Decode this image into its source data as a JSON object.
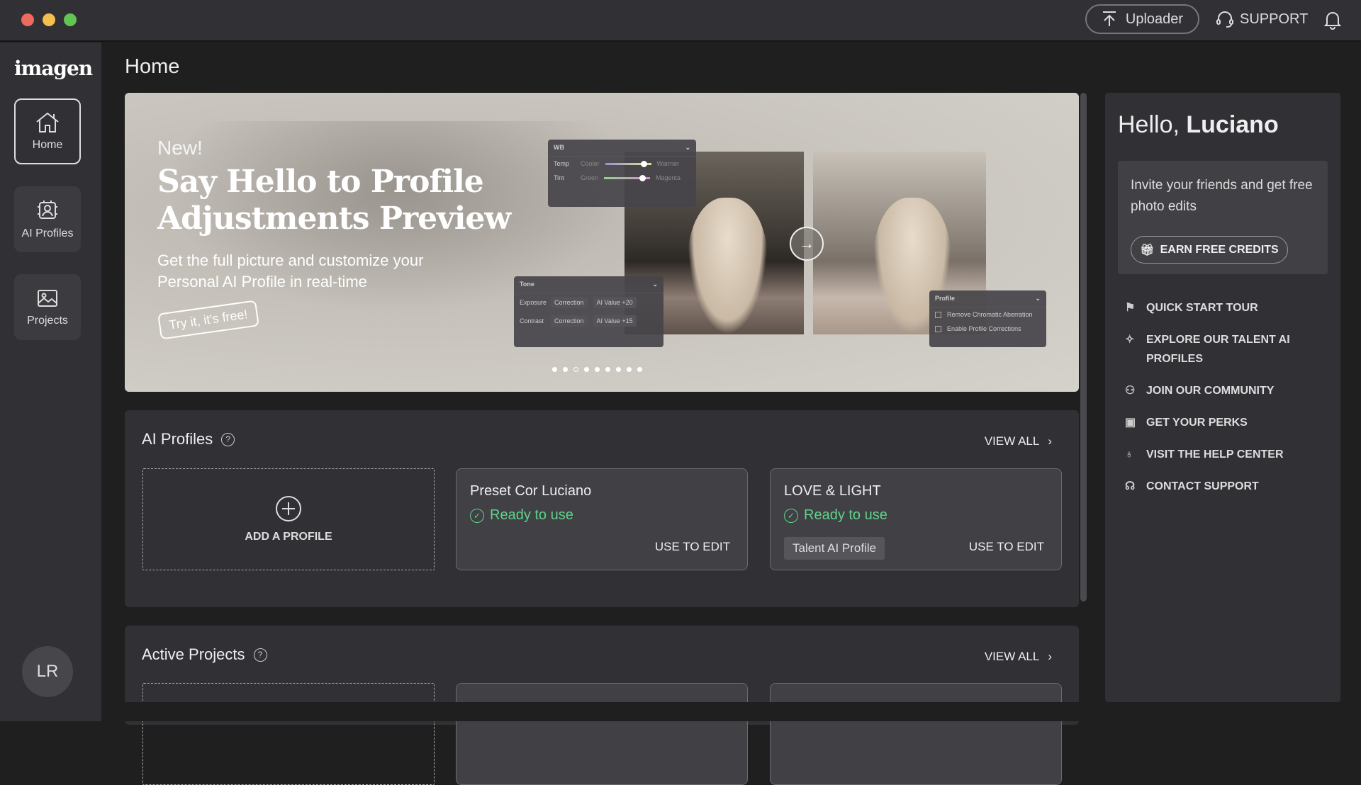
{
  "topbar": {
    "uploader": "Uploader",
    "support": "SUPPORT",
    "colors": {
      "close": "#ed6a5e",
      "minimize": "#f5bf4f",
      "maximize": "#61c554"
    }
  },
  "sidebar": {
    "logo": "imagen",
    "items": [
      {
        "label": "Home",
        "icon": "home-icon",
        "active": true
      },
      {
        "label": "AI Profiles",
        "icon": "ai-profile-icon"
      },
      {
        "label": "Projects",
        "icon": "image-icon"
      }
    ],
    "avatar": "LR"
  },
  "page": {
    "title": "Home"
  },
  "banner": {
    "new": "New!",
    "headline_1": "Say Hello to Profile",
    "headline_2": "Adjustments Preview",
    "subtitle": "Get the full picture and customize your Personal AI Profile in real-time",
    "cta": "Try it, it's free!",
    "wb": {
      "title": "WB",
      "temp": "Temp",
      "cooler": "Cooler",
      "warmer": "Warmer",
      "tint": "Tint",
      "green": "Green",
      "magenta": "Magenta"
    },
    "tone": {
      "title": "Tone",
      "exposure": "Exposure",
      "contrast": "Contrast",
      "correction": "Correction",
      "exposure_value": "AI Value +20",
      "contrast_value": "AI Value +15"
    },
    "profile": {
      "title": "Profile",
      "opt1": "Remove Chromatic Aberration",
      "opt2": "Enable Profile Corrections"
    },
    "slides": 9,
    "current_slide": 3
  },
  "ai_profiles": {
    "title": "AI Profiles",
    "view_all": "VIEW ALL",
    "add": "ADD A PROFILE",
    "cards": [
      {
        "name": "Preset Cor Luciano",
        "status": "Ready to use",
        "action": "USE TO EDIT"
      },
      {
        "name": "LOVE & LIGHT",
        "status": "Ready to use",
        "tag": "Talent AI Profile",
        "action": "USE TO EDIT"
      }
    ]
  },
  "active_projects": {
    "title": "Active Projects",
    "view_all": "VIEW ALL"
  },
  "right": {
    "hello": "Hello, ",
    "name": "Luciano",
    "invite": "Invite your friends and get free photo edits",
    "earn": "EARN FREE CREDITS",
    "links": [
      {
        "label": "QUICK START TOUR",
        "icon": "flag-icon"
      },
      {
        "label": "EXPLORE OUR TALENT AI PROFILES",
        "icon": "sparkle-icon"
      },
      {
        "label": "JOIN OUR COMMUNITY",
        "icon": "users-icon"
      },
      {
        "label": "GET YOUR PERKS",
        "icon": "gift-icon"
      },
      {
        "label": "VISIT THE HELP CENTER",
        "icon": "lightbulb-icon"
      },
      {
        "label": "CONTACT SUPPORT",
        "icon": "headset-icon"
      }
    ]
  }
}
